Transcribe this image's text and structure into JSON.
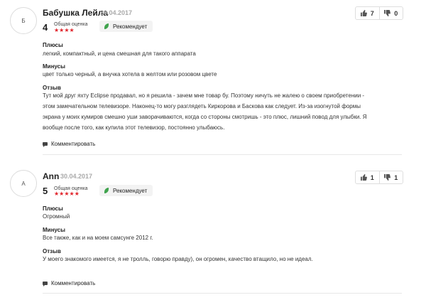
{
  "reviews": [
    {
      "avatar": "Б",
      "author": "Бабушка Лейла",
      "date": "30.04.2017",
      "score": "4",
      "overall_label": "Общая оценка",
      "stars": "★★★★",
      "recommend": "Рекомендует",
      "likes": "7",
      "dislikes": "0",
      "pros_title": "Плюсы",
      "pros": "легкий, компактный, и цена смешная для такого аппарата",
      "cons_title": "Минусы",
      "cons": "цвет только черный, а внучка хотела в желтом или розовом цвете",
      "review_title": "Отзыв",
      "review": "Тут мой друг яхту Eclipse продавал, но я решила - зачем мне товар бу. Поэтому ничуть не жалею о своем приобретении - этом замечательном телевизоре. Наконец-то могу разглядеть Киркорова и Баскова как следует. Из-за изогнутой формы экрана у моих кумиров смешно уши заворачиваются, когда со стороны смотришь - это плюс, лишний повод для улыбки. Я вообще после того, как купила этот телевизор, постоянно улыбаюсь.",
      "comment": "Комментировать"
    },
    {
      "avatar": "А",
      "author": "Ann",
      "date": "30.04.2017",
      "score": "5",
      "overall_label": "Общая оценка",
      "stars": "★★★★★",
      "recommend": "Рекомендует",
      "likes": "1",
      "dislikes": "1",
      "pros_title": "Плюсы",
      "pros": "Огромный",
      "cons_title": "Минусы",
      "cons": "Все также, как и на моем самсунге 2012 г.",
      "review_title": "Отзыв",
      "review": "У моего знакомого имеется, я не тролль, говорю правду), он огромен, качество втащило, но не идеал.",
      "comment": "Комментировать"
    }
  ],
  "icons": {
    "like": "thumb-up-icon",
    "dislike": "thumb-down-icon",
    "recommend": "leaf-icon",
    "comment": "comment-bubble-icon"
  },
  "colors": {
    "stars": "#e0232a",
    "recommend_icon": "#3fa34d"
  }
}
